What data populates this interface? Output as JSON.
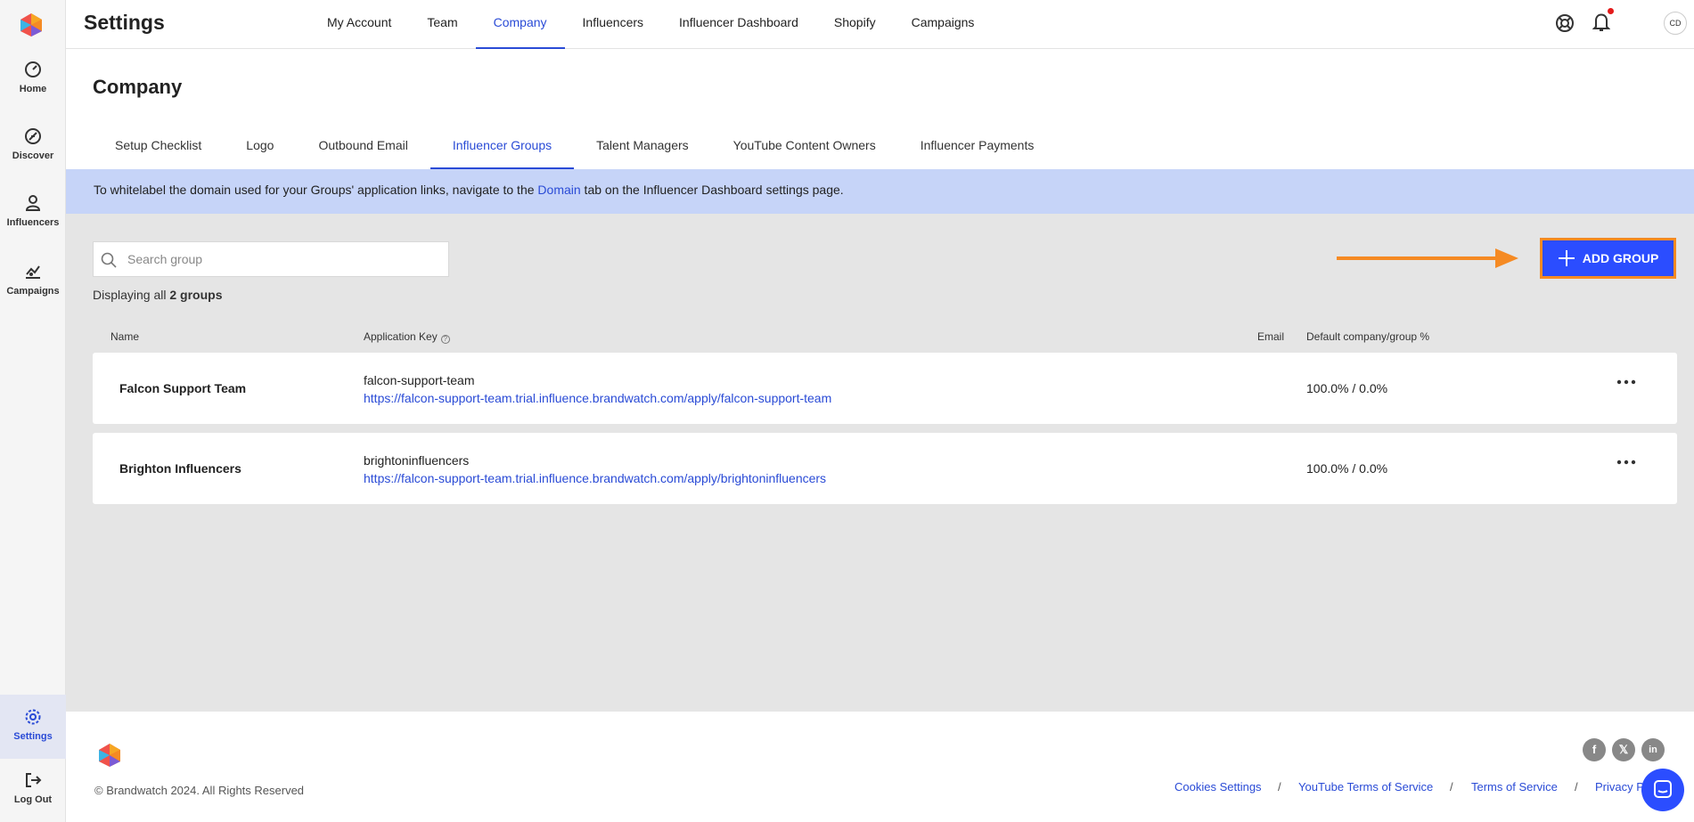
{
  "app": {
    "title": "Settings"
  },
  "sidebar": {
    "items": [
      {
        "label": "Home",
        "icon": "home-icon"
      },
      {
        "label": "Discover",
        "icon": "compass-icon"
      },
      {
        "label": "Influencers",
        "icon": "person-icon"
      },
      {
        "label": "Campaigns",
        "icon": "campaign-chart-icon"
      }
    ],
    "bottom": [
      {
        "label": "Settings",
        "icon": "gear-icon",
        "active": true
      },
      {
        "label": "Log Out",
        "icon": "logout-icon"
      }
    ]
  },
  "topnav": {
    "tabs": [
      "My Account",
      "Team",
      "Company",
      "Influencers",
      "Influencer Dashboard",
      "Shopify",
      "Campaigns"
    ],
    "active": "Company",
    "avatar_initials": "CD"
  },
  "page": {
    "title": "Company",
    "subtabs": [
      "Setup Checklist",
      "Logo",
      "Outbound Email",
      "Influencer Groups",
      "Talent Managers",
      "YouTube Content Owners",
      "Influencer Payments"
    ],
    "active_subtab": "Influencer Groups"
  },
  "notice": {
    "before": "To whitelabel the domain used for your Groups' application links, navigate to the ",
    "link": "Domain",
    "after": " tab on the Influencer Dashboard settings page."
  },
  "search": {
    "placeholder": "Search group"
  },
  "count": {
    "prefix": "Displaying all ",
    "bold": "2 groups"
  },
  "add_button": {
    "label": "ADD GROUP"
  },
  "table": {
    "headers": {
      "name": "Name",
      "key": "Application Key",
      "email": "Email",
      "pct": "Default company/group %"
    },
    "rows": [
      {
        "name": "Falcon Support Team",
        "key": "falcon-support-team",
        "url": "https://falcon-support-team.trial.influence.brandwatch.com/apply/falcon-support-team",
        "pct": "100.0% / 0.0%"
      },
      {
        "name": "Brighton Influencers",
        "key": "brightoninfluencers",
        "url": "https://falcon-support-team.trial.influence.brandwatch.com/apply/brightoninfluencers",
        "pct": "100.0% / 0.0%"
      }
    ]
  },
  "footer": {
    "copyright": "© Brandwatch 2024. All Rights Reserved",
    "links": [
      "Cookies Settings",
      "YouTube Terms of Service",
      "Terms of Service",
      "Privacy P"
    ],
    "separator": "/",
    "social": [
      "f",
      "𝕏",
      "in"
    ]
  },
  "colors": {
    "accent": "#2a4bd6",
    "button": "#2b4dff",
    "highlight": "#f58a23",
    "notice_bg": "#c6d4f8"
  }
}
